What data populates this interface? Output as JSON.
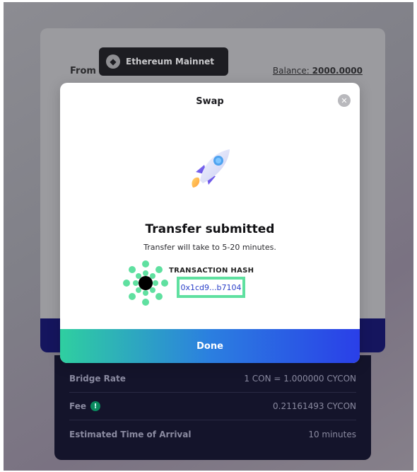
{
  "background": {
    "from_label": "From",
    "network": {
      "label": "Ethereum Mainnet",
      "icon": "ethereum-icon"
    },
    "balance_label": "Balance:",
    "balance_value": "2000.0000"
  },
  "details": [
    {
      "key": "Bridge Rate",
      "value": "1 CON = 1.000000 CYCON",
      "icon": null
    },
    {
      "key": "Fee",
      "value": "0.21161493 CYCON",
      "icon": "info-icon"
    },
    {
      "key": "Estimated Time of Arrival",
      "value": "10 minutes",
      "icon": null
    }
  ],
  "modal": {
    "title": "Swap",
    "close_icon": "close-icon",
    "illustration": "rocket-icon",
    "heading": "Transfer submitted",
    "subtext": "Transfer will take to 5-20 minutes.",
    "hash_label": "TRANSACTION HASH",
    "hash_value": "0x1cd9...b7104",
    "done_label": "Done"
  },
  "colors": {
    "accent_green": "#5fe0a0",
    "link_blue": "#2a3fc8",
    "done_gradient_start": "#2fcfa0",
    "done_gradient_end": "#2a3fe8",
    "panel_dark": "#14142b"
  }
}
